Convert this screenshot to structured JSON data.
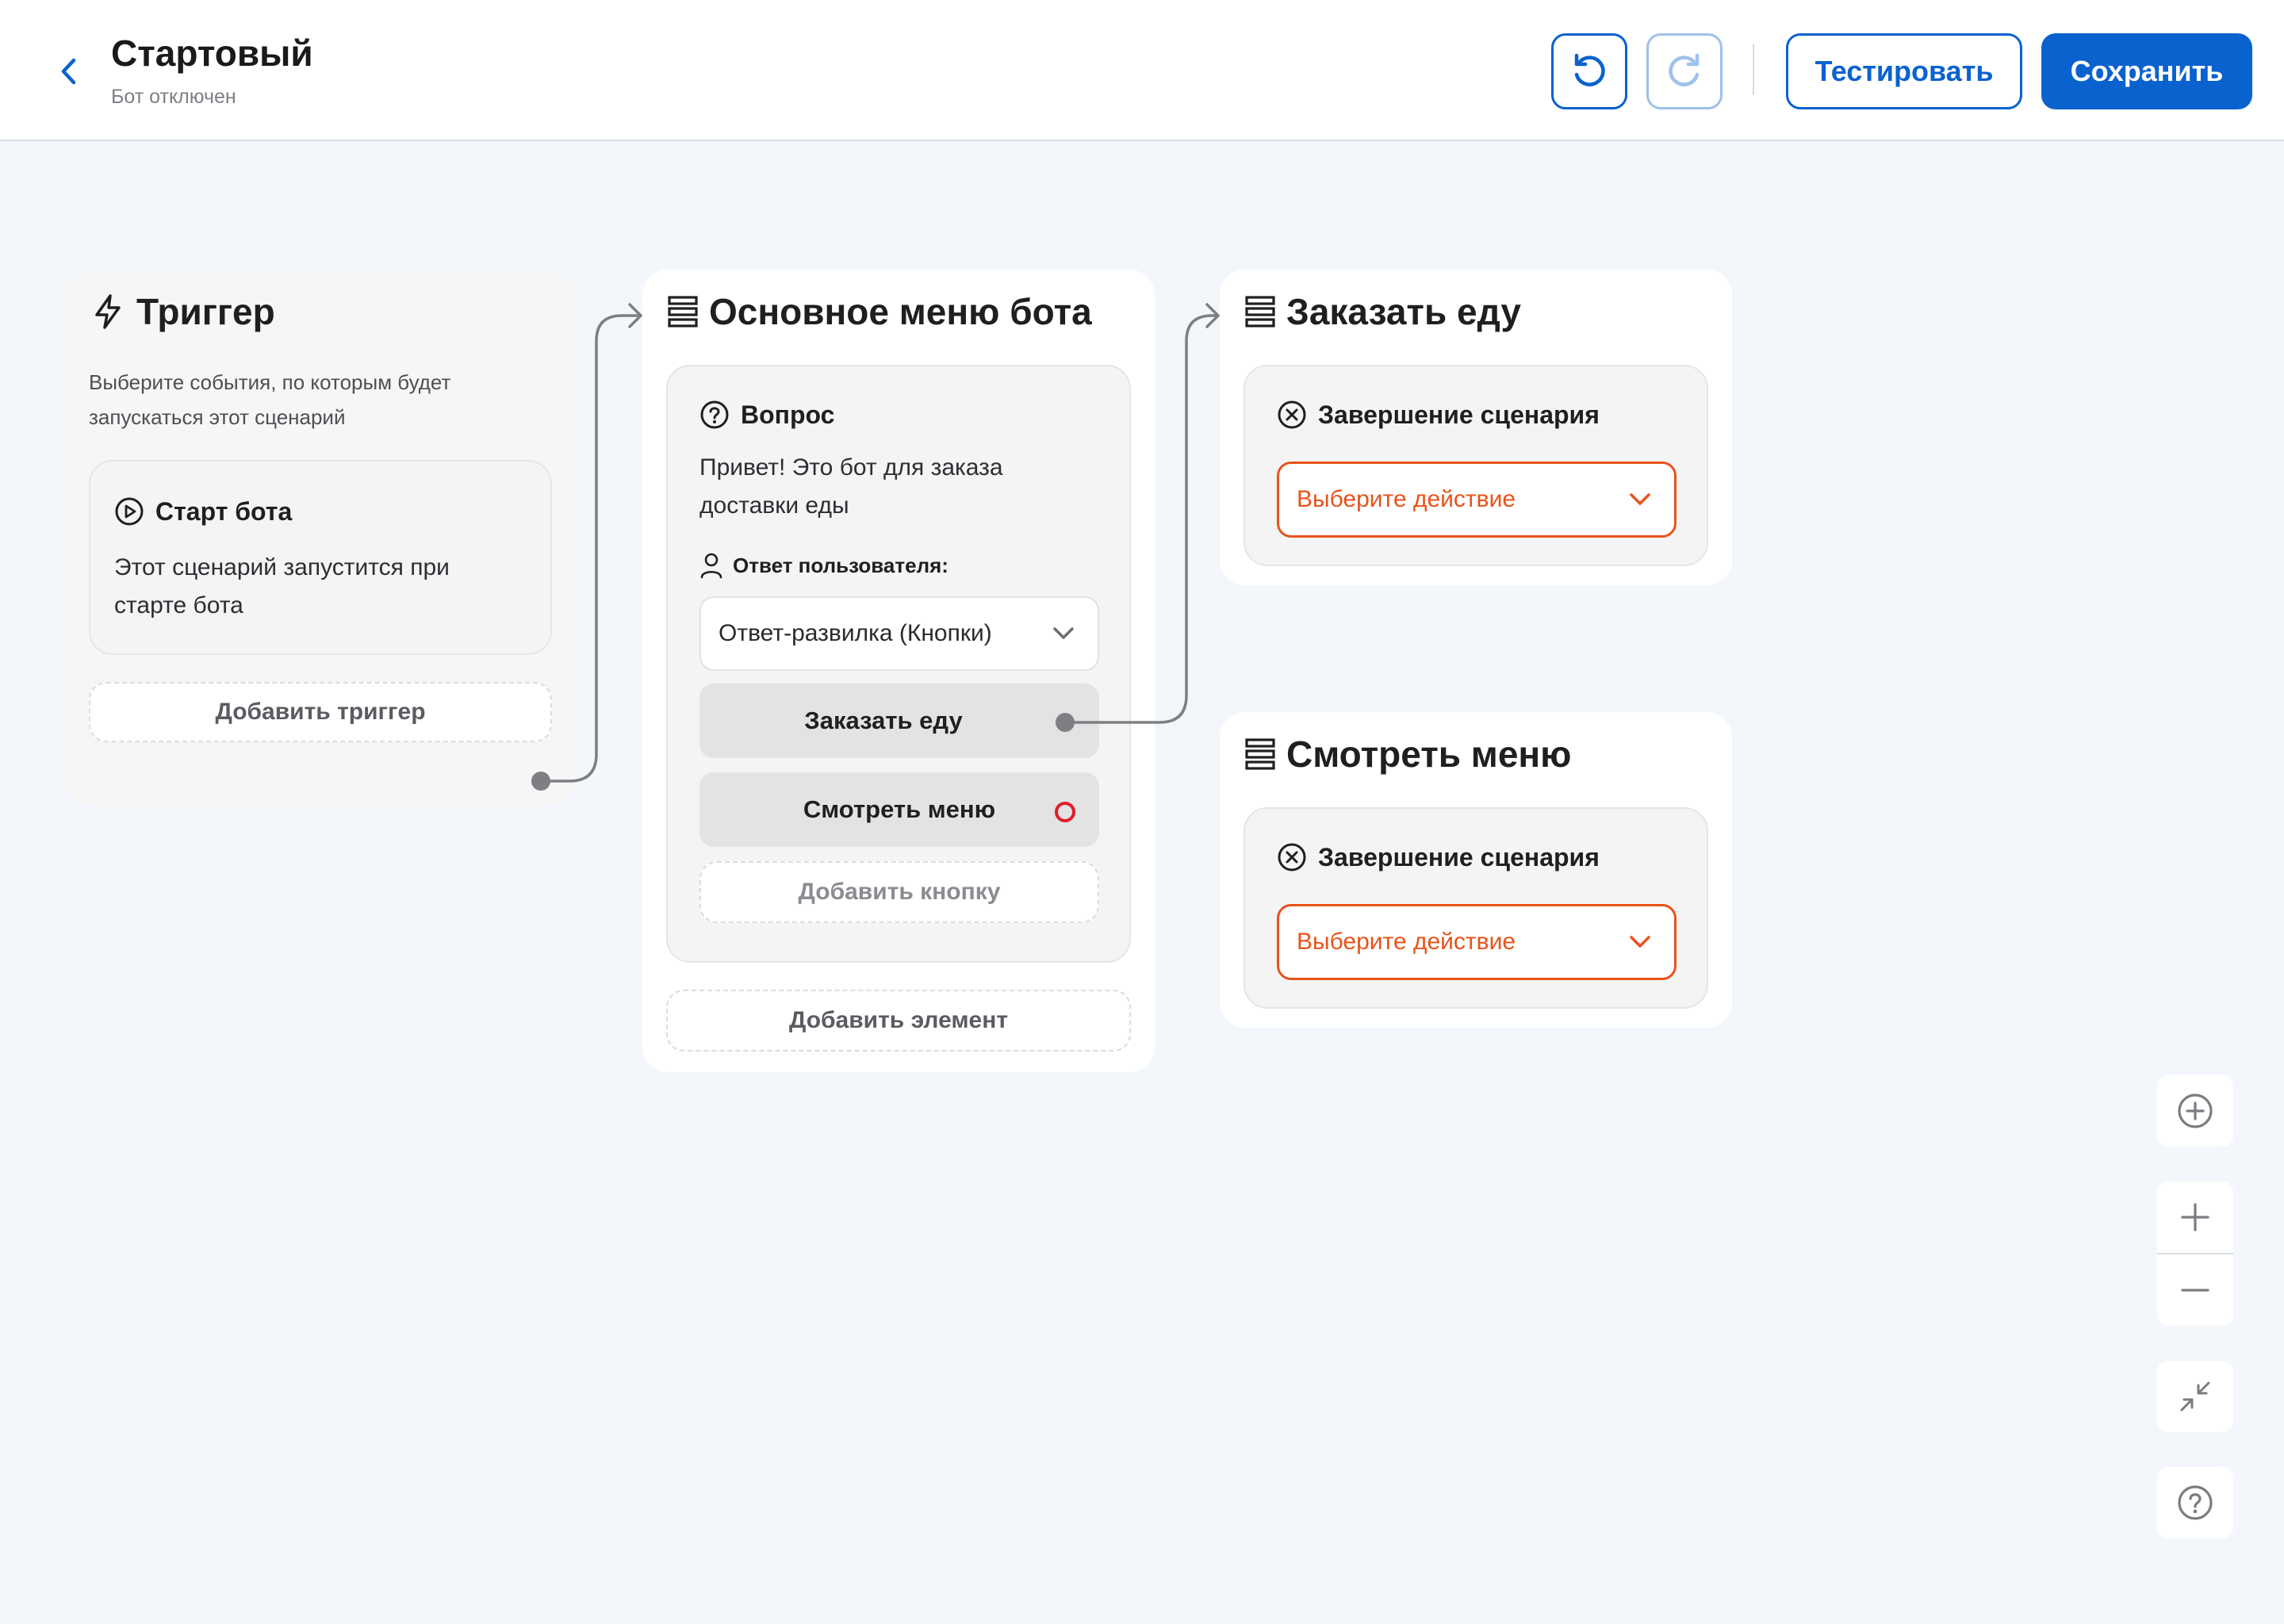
{
  "header": {
    "title": "Стартовый",
    "subtitle": "Бот отключен",
    "test_label": "Тестировать",
    "save_label": "Сохранить"
  },
  "trigger": {
    "title": "Триггер",
    "description": "Выберите события, по которым будет запускаться этот сценарий",
    "event": {
      "title": "Старт бота",
      "description": "Этот сценарий запустится при старте бота"
    },
    "add_label": "Добавить триггер"
  },
  "main_menu": {
    "title": "Основное меню бота",
    "question": {
      "title": "Вопрос",
      "text": "Привет! Это бот для заказа доставки еды",
      "answer_label": "Ответ пользователя:",
      "answer_type": "Ответ-развилка (Кнопки)",
      "buttons": [
        "Заказать еду",
        "Смотреть меню"
      ],
      "add_button_label": "Добавить кнопку"
    },
    "add_element_label": "Добавить элемент"
  },
  "order_food": {
    "title": "Заказать еду",
    "block_title": "Завершение сценария",
    "select_placeholder": "Выберите действие"
  },
  "view_menu": {
    "title": "Смотреть меню",
    "block_title": "Завершение сценария",
    "select_placeholder": "Выберите действие"
  },
  "icons": [
    "chevron-left-icon",
    "undo-icon",
    "redo-icon",
    "lightning-icon",
    "play-circle-icon",
    "list-icon",
    "question-circle-icon",
    "user-icon",
    "chevron-down-icon",
    "close-circle-icon",
    "plus-circle-icon",
    "plus-icon",
    "minus-icon",
    "collapse-icon",
    "help-icon"
  ],
  "colors": {
    "primary": "#0a62cf",
    "warning": "#e8531a",
    "unconnected_port": "#e01e2b",
    "background": "#f3f7fc"
  }
}
